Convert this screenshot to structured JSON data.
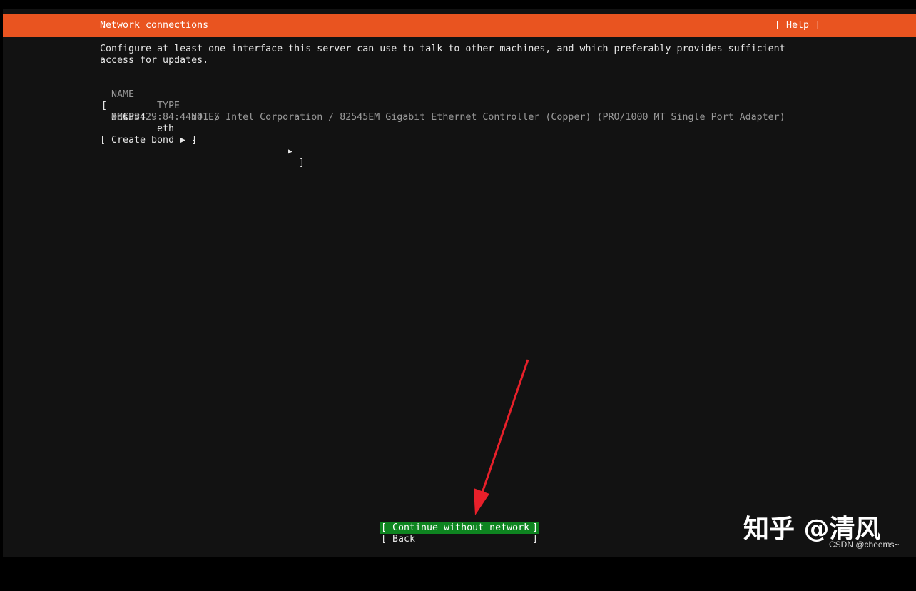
{
  "header": {
    "title": "Network connections",
    "help_label": "[ Help ]"
  },
  "intro": {
    "line1": "Configure at least one interface this server can use to talk to other machines, and which preferably provides sufficient",
    "line2": "access for updates."
  },
  "table": {
    "headers": [
      "NAME",
      "TYPE",
      "NOTES"
    ],
    "rows": [
      {
        "open_bracket": "[",
        "name": "ens33",
        "type": "eth",
        "notes": "-",
        "arrow": "▶",
        "close_bracket": "]",
        "dhcp_label": "DHCPv4",
        "dhcp_value": "-",
        "description": "00:0c:29:84:44:41 / Intel Corporation / 82545EM Gigabit Ethernet Controller (Copper) (PRO/1000 MT Single Port Adapter)"
      }
    ]
  },
  "create_bond": {
    "label": "[ Create bond ▶ ]"
  },
  "buttons": {
    "continue": {
      "open": "[",
      "label": "Continue without network",
      "close": "]"
    },
    "back": {
      "open": "[",
      "label": "Back",
      "close": "]"
    }
  },
  "watermark": {
    "text": "知乎 @清风",
    "csdn": "CSDN @cheems~"
  },
  "colors": {
    "header_bg": "#e95420",
    "screen_bg": "#121212",
    "focus_bg": "#0e8420",
    "annotation_arrow": "#e8202a"
  }
}
